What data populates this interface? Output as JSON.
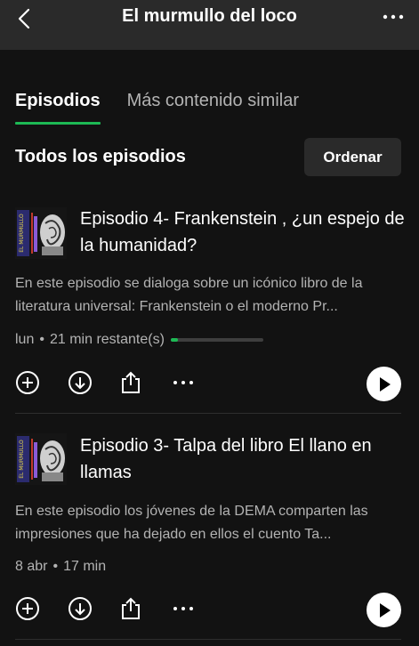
{
  "header": {
    "title": "El murmullo del loco"
  },
  "tabs": [
    {
      "label": "Episodios",
      "active": true
    },
    {
      "label": "Más contenido similar",
      "active": false
    }
  ],
  "section": {
    "title": "Todos los episodios",
    "sort_label": "Ordenar"
  },
  "episodes": [
    {
      "title": "Episodio 4- Frankenstein , ¿un espejo de la humanidad?",
      "description": "En este episodio se dialoga sobre un icónico libro de la literatura universal: Frankenstein o el moderno Pr...",
      "date": "lun",
      "duration": "21 min restante(s)",
      "progress": 0.08
    },
    {
      "title": "Episodio 3- Talpa del libro El llano en llamas",
      "description": "En este episodio los jóvenes de la DEMA comparten las impresiones que ha dejado en ellos el cuento Ta...",
      "date": "8 abr",
      "duration": "17 min"
    }
  ],
  "icons": [
    "back-arrow-icon",
    "more-icon",
    "add-icon",
    "download-icon",
    "share-icon",
    "more-options-icon",
    "play-icon"
  ],
  "colors": {
    "background": "#121212",
    "topbar": "#2a2a2a",
    "accent": "#1db954",
    "secondary_text": "#b3b3b3"
  }
}
